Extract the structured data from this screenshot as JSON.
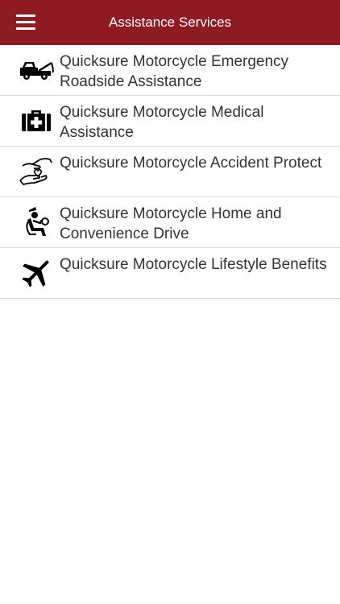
{
  "header": {
    "title": "Assistance Services",
    "menu_icon": "hamburger-menu-icon"
  },
  "colors": {
    "header_bg": "#8e1a22",
    "text": "#333333",
    "divider": "#d9d9d9"
  },
  "services": [
    {
      "label": "Quicksure Motorcycle Emergency Roadside Assistance",
      "icon": "tow-truck-icon"
    },
    {
      "label": "Quicksure Motorcycle Medical Assistance",
      "icon": "medical-kit-icon"
    },
    {
      "label": "Quicksure Motorcycle Accident Protect",
      "icon": "caring-hands-icon"
    },
    {
      "label": "Quicksure Motorcycle Home and Convenience Drive",
      "icon": "seated-driver-icon"
    },
    {
      "label": "Quicksure Motorcycle Lifestyle Benefits",
      "icon": "airplane-icon"
    }
  ]
}
